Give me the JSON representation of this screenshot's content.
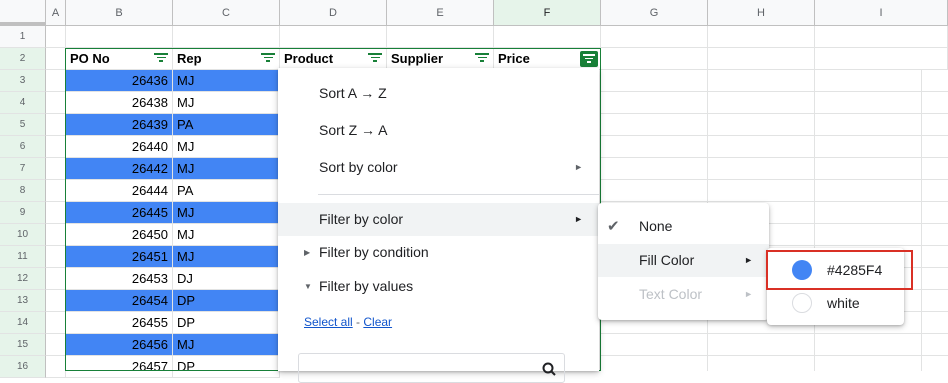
{
  "columns": [
    "A",
    "B",
    "C",
    "D",
    "E",
    "F",
    "G",
    "H",
    "I"
  ],
  "rows": [
    "1",
    "2",
    "3",
    "4",
    "5",
    "6",
    "7",
    "8",
    "9",
    "10",
    "11",
    "12",
    "13",
    "14",
    "15",
    "16"
  ],
  "headers": [
    "PO No",
    "Rep",
    "Product",
    "Supplier",
    "Price"
  ],
  "data": [
    {
      "po": "26436",
      "rep": "MJ"
    },
    {
      "po": "26438",
      "rep": "MJ"
    },
    {
      "po": "26439",
      "rep": "PA"
    },
    {
      "po": "26440",
      "rep": "MJ"
    },
    {
      "po": "26442",
      "rep": "MJ"
    },
    {
      "po": "26444",
      "rep": "PA"
    },
    {
      "po": "26445",
      "rep": "MJ"
    },
    {
      "po": "26450",
      "rep": "MJ"
    },
    {
      "po": "26451",
      "rep": "MJ"
    },
    {
      "po": "26453",
      "rep": "DJ"
    },
    {
      "po": "26454",
      "rep": "DP"
    },
    {
      "po": "26455",
      "rep": "DP"
    },
    {
      "po": "26456",
      "rep": "MJ"
    },
    {
      "po": "26457",
      "rep": "DP"
    }
  ],
  "menu": {
    "sort_az": "Sort A → Z",
    "sort_za": "Sort Z → A",
    "sort_by_color": "Sort by color",
    "filter_by_color": "Filter by color",
    "filter_by_condition": "Filter by condition",
    "filter_by_values": "Filter by values",
    "select_all": "Select all",
    "link_sep": " - ",
    "clear": "Clear"
  },
  "submenu": {
    "none": "None",
    "fill_color": "Fill Color",
    "text_color": "Text Color"
  },
  "colors_menu": [
    {
      "label": "#4285F4",
      "color": "#4285F4"
    },
    {
      "label": "white",
      "color": "#ffffff"
    }
  ]
}
